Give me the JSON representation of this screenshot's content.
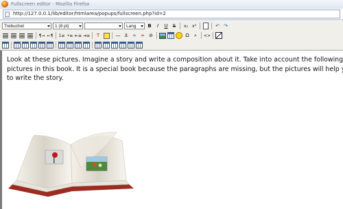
{
  "window": {
    "title": "Fullscreen editor - Mozilla Firefox"
  },
  "address_bar": {
    "url": "http://127.0.0.1/lib/editor/htmlarea/popups/fullscreen.php?id=2"
  },
  "toolbar": {
    "font_family": "Trebuchet",
    "font_size": "1 (8 pt)",
    "format_block": "",
    "language": "Lang",
    "bold_label": "B",
    "italic_label": "I",
    "underline_label": "U",
    "strike_label": "S",
    "subscript_label": "x₂",
    "superscript_label": "x²"
  },
  "content": {
    "lines": [
      "Look at these pictures. Imagine a story and write a composition about it. Take into account the following",
      "pictures in this book. It is a special book because the paragraphs are missing, but the pictures will help you",
      "to write the story."
    ]
  }
}
